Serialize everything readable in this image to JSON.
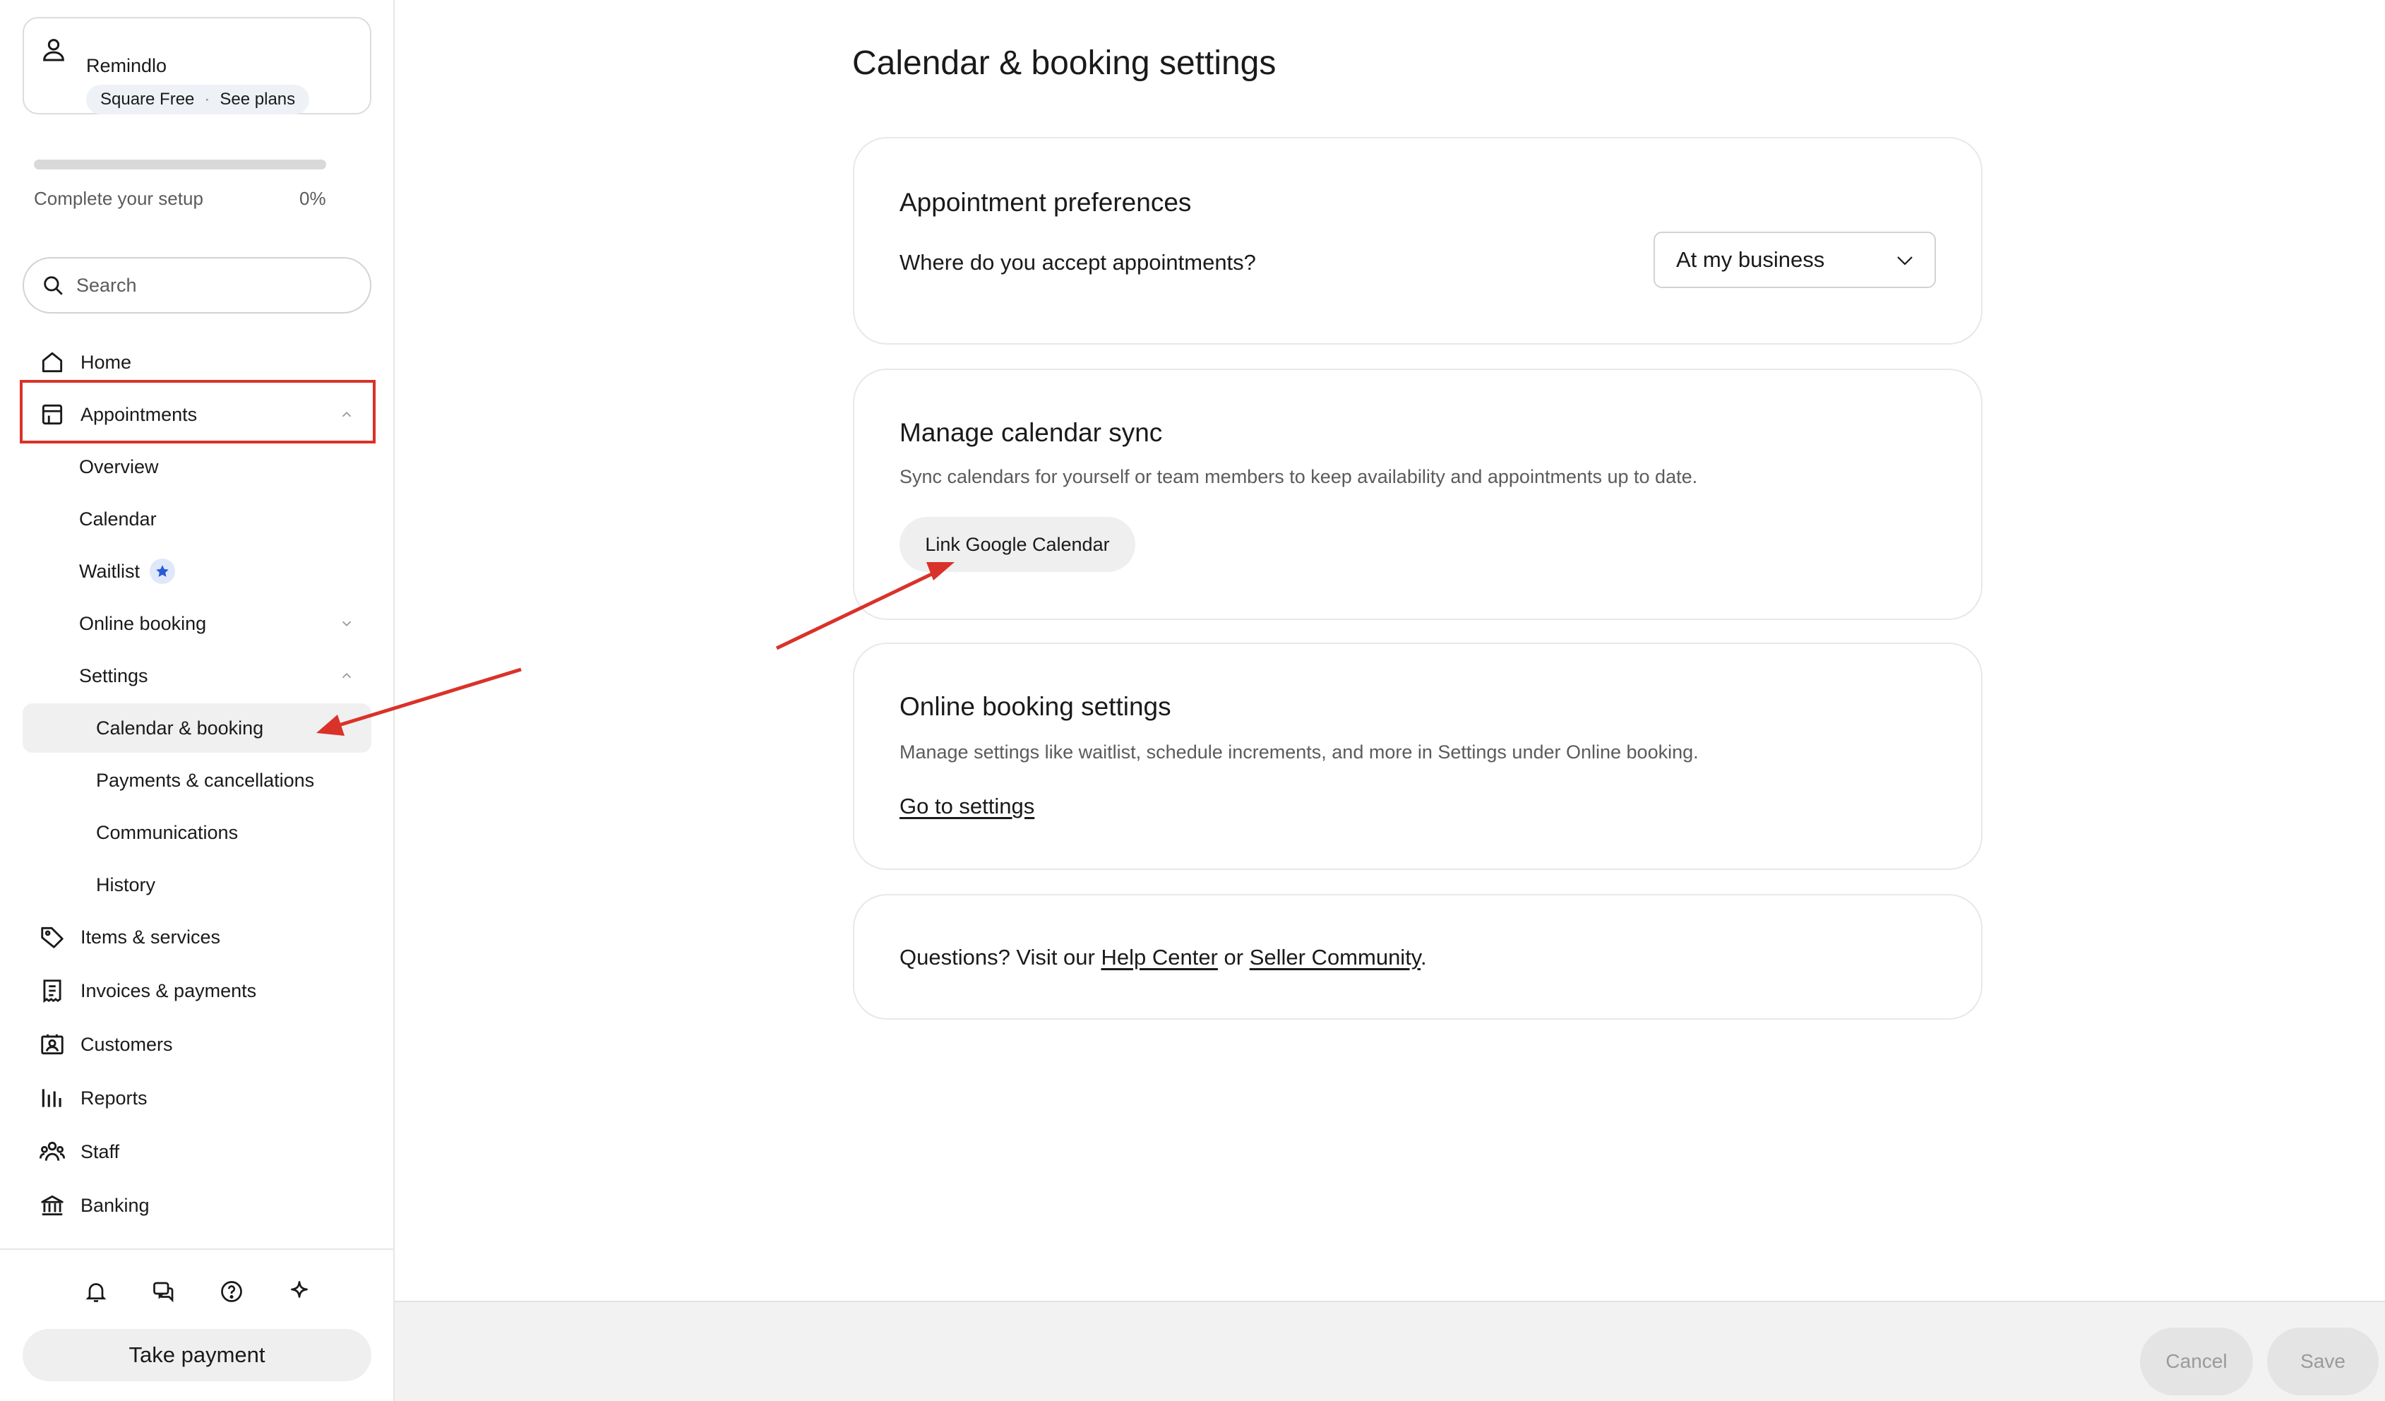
{
  "account": {
    "name": "Remindlo",
    "plan": "Square Free",
    "separator": "·",
    "plans_link": "See plans"
  },
  "setup": {
    "label": "Complete your setup",
    "percent_text": "0%",
    "progress": 0
  },
  "search": {
    "placeholder": "Search"
  },
  "nav": {
    "home": "Home",
    "appointments": "Appointments",
    "overview": "Overview",
    "calendar": "Calendar",
    "waitlist": "Waitlist",
    "online_booking": "Online booking",
    "settings": "Settings",
    "calendar_booking": "Calendar & booking",
    "payments_cancellations": "Payments & cancellations",
    "communications": "Communications",
    "history": "History",
    "items_services": "Items & services",
    "invoices_payments": "Invoices & payments",
    "customers": "Customers",
    "reports": "Reports",
    "staff": "Staff",
    "banking": "Banking"
  },
  "footer": {
    "take_payment": "Take payment",
    "icons": [
      "bell-icon",
      "chat-icon",
      "help-icon",
      "sparkle-icon"
    ]
  },
  "page": {
    "title": "Calendar & booking settings"
  },
  "appointment_preferences": {
    "heading": "Appointment preferences",
    "question": "Where do you accept appointments?",
    "selected": "At my business"
  },
  "calendar_sync": {
    "heading": "Manage calendar sync",
    "description": "Sync calendars for yourself or team members to keep availability and appointments up to date.",
    "button": "Link Google Calendar"
  },
  "online_booking_settings": {
    "heading": "Online booking settings",
    "description": "Manage settings like waitlist, schedule increments, and more in Settings under Online booking.",
    "link": "Go to settings"
  },
  "help": {
    "prefix": "Questions? Visit our ",
    "help_center": "Help Center",
    "or": " or ",
    "community": "Seller Community",
    "suffix": "."
  },
  "actions": {
    "cancel": "Cancel",
    "save": "Save"
  },
  "colors": {
    "annotation": "#d9322a",
    "accent_star": "#2a5bd7"
  }
}
